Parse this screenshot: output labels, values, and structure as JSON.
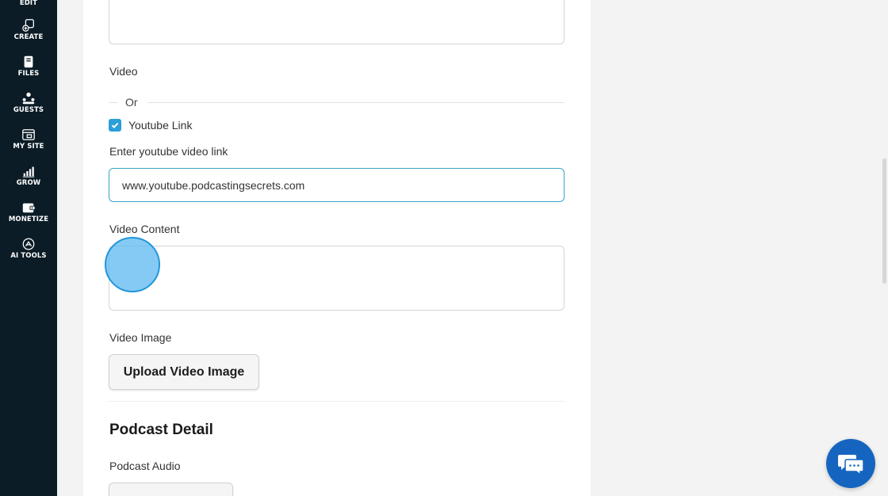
{
  "sidebar": {
    "items": [
      {
        "label": "EDIT",
        "icon": "edit-icon"
      },
      {
        "label": "CREATE",
        "icon": "create-icon"
      },
      {
        "label": "FILES",
        "icon": "files-icon"
      },
      {
        "label": "GUESTS",
        "icon": "guests-icon"
      },
      {
        "label": "MY SITE",
        "icon": "my-site-icon"
      },
      {
        "label": "GROW",
        "icon": "grow-icon"
      },
      {
        "label": "MONETIZE",
        "icon": "monetize-icon"
      },
      {
        "label": "AI TOOLS",
        "icon": "ai-tools-icon"
      }
    ]
  },
  "form": {
    "video_label": "Video",
    "or_text": "Or",
    "youtube_checkbox_label": "Youtube Link",
    "youtube_checked": true,
    "youtube_link_label": "Enter youtube video link",
    "youtube_link_value": "www.youtube.podcastingsecrets.com",
    "video_content_label": "Video Content",
    "video_image_label": "Video Image",
    "upload_video_image_button": "Upload Video Image",
    "podcast_detail_title": "Podcast Detail",
    "podcast_audio_label": "Podcast Audio"
  },
  "chat": {
    "icon": "chat-bubble-icon"
  },
  "colors": {
    "sidebar_bg": "#0b1c26",
    "accent": "#2a9fd8",
    "chat": "#1565c0"
  }
}
